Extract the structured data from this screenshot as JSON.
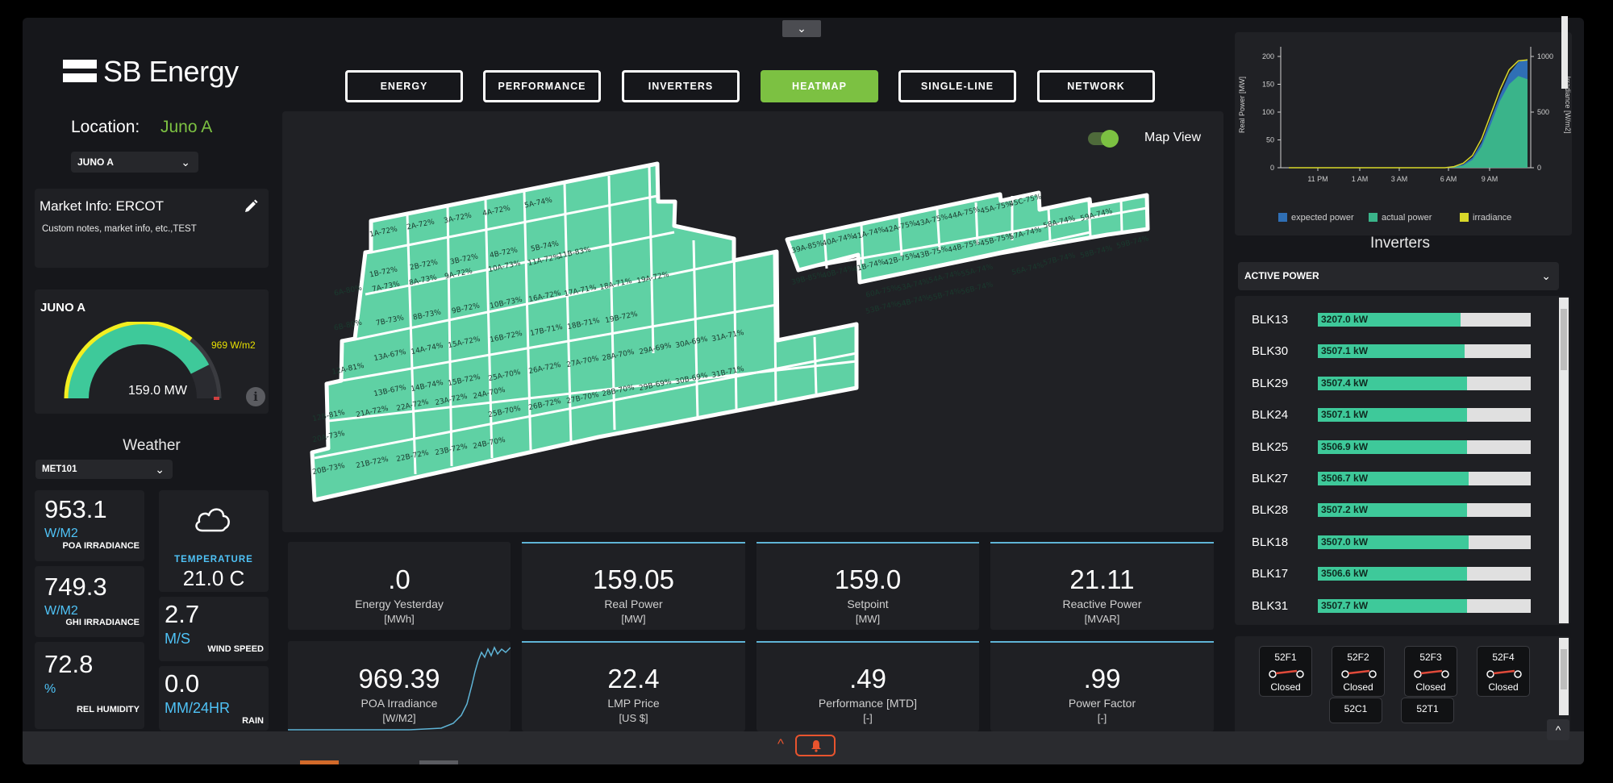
{
  "logo": {
    "text": "SB Energy"
  },
  "location": {
    "label": "Location:",
    "value": "Juno A",
    "dropdown": "JUNO A"
  },
  "market": {
    "title": "Market Info: ERCOT",
    "notes": "Custom notes, market info, etc.,TEST",
    "edit_icon": "pencil-icon"
  },
  "gauge": {
    "title": "JUNO A",
    "irradiance": "969 W/m2",
    "power": "159.0 MW",
    "fraction": 0.85
  },
  "weather": {
    "title": "Weather",
    "station": "MET101",
    "poa": {
      "value": "953.1",
      "unit": "W/M2",
      "label": "POA IRRADIANCE"
    },
    "ghi": {
      "value": "749.3",
      "unit": "W/M2",
      "label": "GHI IRRADIANCE"
    },
    "humidity": {
      "value": "72.8",
      "unit": "%",
      "label": "REL HUMIDITY"
    },
    "temperature": {
      "label": "TEMPERATURE",
      "value": "21.0 C",
      "icon": "cloud-icon"
    },
    "wind": {
      "value": "2.7",
      "unit": "M/S",
      "label": "WIND SPEED"
    },
    "rain": {
      "value": "0.0",
      "unit": "MM/24HR",
      "label": "RAIN"
    }
  },
  "tabs": [
    "ENERGY",
    "PERFORMANCE",
    "INVERTERS",
    "HEATMAP",
    "SINGLE-LINE",
    "NETWORK"
  ],
  "active_tab": "HEATMAP",
  "heatmap": {
    "map_view_label": "Map View",
    "blocks_left": [
      "1A-72%",
      "2A-72%",
      "3A-72%",
      "4A-72%",
      "5A-74%",
      "1B-72%",
      "2B-72%",
      "3B-72%",
      "4B-72%",
      "5B-74%",
      "6A-80%",
      "7A-73%",
      "8A-73%",
      "9A-72%",
      "10A-73%",
      "11A-72%",
      "11B-83%",
      "6B-80%",
      "7B-73%",
      "8B-73%",
      "9B-72%",
      "10B-73%",
      "16A-72%",
      "17A-71%",
      "18A-71%",
      "19A-72%",
      "13A-67%",
      "14A-74%",
      "15A-72%",
      "16B-72%",
      "17B-71%",
      "18B-71%",
      "19B-72%",
      "12A-81%",
      "13B-67%",
      "14B-74%",
      "15B-72%",
      "25A-70%",
      "26A-72%",
      "27A-70%",
      "28A-70%",
      "29A-69%",
      "30A-69%",
      "31A-71%",
      "12B-81%",
      "21A-72%",
      "22A-72%",
      "23A-72%",
      "24A-70%",
      "20A-73%",
      "25B-70%",
      "26B-72%",
      "27B-70%",
      "28B-70%",
      "29B-69%",
      "30B-69%",
      "31B-71%",
      "20B-73%",
      "21B-72%",
      "22B-72%",
      "23B-72%",
      "24B-70%"
    ],
    "blocks_right": [
      "39A-85%",
      "40A-74%",
      "41A-74%",
      "42A-75%",
      "43A-75%",
      "44A-75%",
      "45A-75%",
      "45C-75%",
      "39B-85%",
      "40B-74%",
      "41B-74%",
      "42B-75%",
      "43B-75%",
      "44B-75%",
      "45B-75%",
      "57A-74%",
      "58A-74%",
      "59A-74%",
      "60A-75%",
      "53A-74%",
      "54A-74%",
      "55A-74%",
      "56A-74%",
      "57B-74%",
      "58B-74%",
      "59B-74%",
      "53B-74%",
      "54B-74%",
      "55B-74%",
      "56B-74%"
    ]
  },
  "kpis": [
    {
      "value": ".0",
      "label": "Energy Yesterday",
      "unit": "[MWh]"
    },
    {
      "value": "159.05",
      "label": "Real Power",
      "unit": "[MW]"
    },
    {
      "value": "159.0",
      "label": "Setpoint",
      "unit": "[MW]"
    },
    {
      "value": "21.11",
      "label": "Reactive Power",
      "unit": "[MVAR]"
    },
    {
      "value": "969.39",
      "label": "POA Irradiance",
      "unit": "[W/M2]"
    },
    {
      "value": "22.4",
      "label": "LMP Price",
      "unit": "[US $]"
    },
    {
      "value": ".49",
      "label": "Performance [MTD]",
      "unit": "[-]"
    },
    {
      "value": ".99",
      "label": "Power Factor",
      "unit": "[-]"
    }
  ],
  "chart_data": {
    "type": "area",
    "y_left_label": "Real Power [MW]",
    "y_right_label": "Irradiance [W/m2]",
    "y_left_ticks": [
      "0",
      "50",
      "100",
      "150",
      "200"
    ],
    "y_right_ticks": [
      "0",
      "500",
      "1000"
    ],
    "x_ticks": [
      "11 PM",
      "1 AM",
      "3 AM",
      "6 AM",
      "9 AM"
    ],
    "legend": [
      "expected power",
      "actual power",
      "irradiance"
    ],
    "colors": {
      "expected": "#2f6fb5",
      "actual": "#3ab48a",
      "irradiance": "#d8d82a"
    },
    "series": [
      {
        "name": "expected power",
        "values": [
          0,
          0,
          0,
          0,
          0,
          0,
          0,
          0,
          0,
          0,
          0,
          0,
          0,
          0,
          0,
          0,
          0,
          0,
          2,
          6,
          18,
          45,
          88,
          130,
          168,
          190,
          195
        ]
      },
      {
        "name": "actual power",
        "values": [
          0,
          0,
          0,
          0,
          0,
          0,
          0,
          0,
          0,
          0,
          0,
          0,
          0,
          0,
          0,
          0,
          0,
          0,
          1,
          4,
          14,
          38,
          78,
          120,
          150,
          165,
          159
        ]
      },
      {
        "name": "irradiance",
        "values": [
          0,
          0,
          0,
          0,
          0,
          0,
          0,
          0,
          0,
          0,
          0,
          0,
          0,
          0,
          0,
          0,
          0,
          0,
          10,
          40,
          110,
          260,
          480,
          700,
          880,
          960,
          969
        ]
      }
    ]
  },
  "inverters": {
    "title": "Inverters",
    "metric": "ACTIVE POWER",
    "rows": [
      {
        "name": "BLK13",
        "value": "3207.0 kW",
        "fraction": 0.67
      },
      {
        "name": "BLK30",
        "value": "3507.1 kW",
        "fraction": 0.69
      },
      {
        "name": "BLK29",
        "value": "3507.4 kW",
        "fraction": 0.7
      },
      {
        "name": "BLK24",
        "value": "3507.1 kW",
        "fraction": 0.7
      },
      {
        "name": "BLK25",
        "value": "3506.9 kW",
        "fraction": 0.7
      },
      {
        "name": "BLK27",
        "value": "3506.7 kW",
        "fraction": 0.71
      },
      {
        "name": "BLK28",
        "value": "3507.2 kW",
        "fraction": 0.7
      },
      {
        "name": "BLK18",
        "value": "3507.0 kW",
        "fraction": 0.71
      },
      {
        "name": "BLK17",
        "value": "3506.6 kW",
        "fraction": 0.7
      },
      {
        "name": "BLK31",
        "value": "3507.7 kW",
        "fraction": 0.7
      }
    ]
  },
  "breakers": [
    {
      "name": "52F1",
      "state": "Closed"
    },
    {
      "name": "52F2",
      "state": "Closed"
    },
    {
      "name": "52F3",
      "state": "Closed"
    },
    {
      "name": "52F4",
      "state": "Closed"
    },
    {
      "name": "52C1",
      "state": ""
    },
    {
      "name": "52T1",
      "state": ""
    }
  ]
}
